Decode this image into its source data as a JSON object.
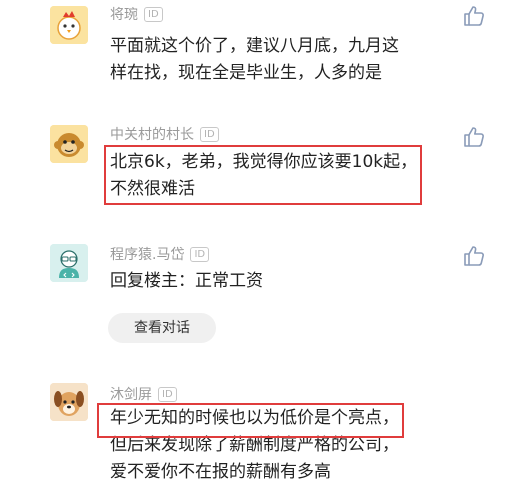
{
  "comments": [
    {
      "username": "将琬",
      "id_badge": "ID",
      "lines": [
        "平面就这个价了，建议八月底，九月这",
        "样在找，现在全是毕业生，人多的是"
      ]
    },
    {
      "username": "中关村的村长",
      "id_badge": "ID",
      "lines": [
        "北京6k，老弟，我觉得你应该要10k起，",
        "不然很难活"
      ]
    },
    {
      "username": "程序猿.马岱",
      "id_badge": "ID",
      "lines": [
        "回复楼主：正常工资"
      ],
      "reply_button": "查看对话"
    },
    {
      "username": "沐剑屏",
      "id_badge": "ID",
      "lines": [
        "年少无知的时候也以为低价是个亮点，",
        "但后来发现除了薪酬制度严格的公司，",
        "爱不爱你不在报的薪酬有多高"
      ]
    }
  ],
  "colors": {
    "highlight": "#e03c3c",
    "username": "#9a9a9a",
    "text": "#222222",
    "like_icon": "#8a9bb8"
  },
  "icons": [
    "chicken-avatar-icon",
    "monkey-avatar-icon",
    "programmer-avatar-icon",
    "dog-avatar-icon",
    "thumbs-up-icon"
  ]
}
